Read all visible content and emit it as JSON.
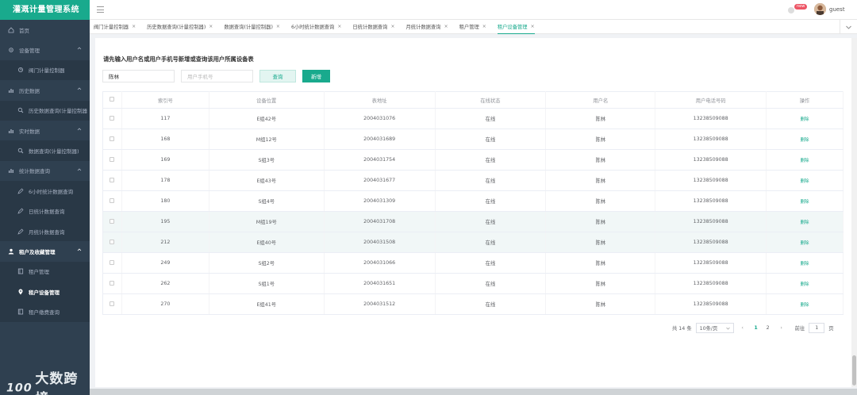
{
  "app": {
    "title": "灌溉计量管理系统"
  },
  "header": {
    "badge": "new",
    "username": "guest"
  },
  "sidebar": {
    "items": [
      {
        "label": "首页",
        "type": "group",
        "icon": "home-icon"
      },
      {
        "label": "设备管理",
        "type": "group",
        "icon": "gear-icon",
        "expanded": true
      },
      {
        "label": "阀门计量控制器",
        "type": "sub",
        "icon": "valve-icon"
      },
      {
        "label": "历史数据",
        "type": "group",
        "icon": "chart-icon",
        "expanded": true
      },
      {
        "label": "历史数据查询(计量控制器",
        "type": "sub",
        "icon": "search-icon"
      },
      {
        "label": "实时数据",
        "type": "group",
        "icon": "chart-icon",
        "expanded": true
      },
      {
        "label": "数据查询(计量控制器)",
        "type": "sub",
        "icon": "search-icon"
      },
      {
        "label": "统计数据查询",
        "type": "group",
        "icon": "chart-icon",
        "expanded": true
      },
      {
        "label": "6小时统计数据查询",
        "type": "sub",
        "icon": "edit-icon"
      },
      {
        "label": "日统计数据查询",
        "type": "sub",
        "icon": "edit-icon"
      },
      {
        "label": "月统计数据查询",
        "type": "sub",
        "icon": "edit-icon"
      },
      {
        "label": "租户及收藏管理",
        "type": "group",
        "icon": "user-icon",
        "expanded": true,
        "strong": true
      },
      {
        "label": "租户管理",
        "type": "sub",
        "icon": "book-icon"
      },
      {
        "label": "租户设备管理",
        "type": "sub",
        "icon": "pin-icon",
        "active": true
      },
      {
        "label": "租户缴费查询",
        "type": "sub",
        "icon": "book-icon"
      }
    ],
    "watermark": "大数跨境"
  },
  "tabs": [
    {
      "label": "阀门计量控制器",
      "close": "×"
    },
    {
      "label": "历史数据查询(计量控制器)",
      "close": "×"
    },
    {
      "label": "数据查询(计量控制器)",
      "close": "×"
    },
    {
      "label": "6小时统计数据查询",
      "close": "×"
    },
    {
      "label": "日统计数据查询",
      "close": "×"
    },
    {
      "label": "月统计数据查询",
      "close": "×"
    },
    {
      "label": "租户管理",
      "close": "×"
    },
    {
      "label": "租户设备管理",
      "close": "×",
      "active": true
    }
  ],
  "main": {
    "title": "请先输入用户名或用户手机号新增或查询该用户所属设备表",
    "name_value": "陈林",
    "phone_placeholder": "用户手机号",
    "query_label": "查询",
    "add_label": "新增"
  },
  "table": {
    "columns": [
      "",
      "索引号",
      "设备位置",
      "表地址",
      "在线状态",
      "用户名",
      "用户电话号码",
      "操作"
    ],
    "rows": [
      {
        "index": "117",
        "location": "E组42号",
        "address": "2004031076",
        "status": "在线",
        "user": "陈林",
        "phone": "13238509088",
        "action": "删除"
      },
      {
        "index": "168",
        "location": "M组12号",
        "address": "2004031689",
        "status": "在线",
        "user": "陈林",
        "phone": "13238509088",
        "action": "删除"
      },
      {
        "index": "169",
        "location": "S组3号",
        "address": "2004031754",
        "status": "在线",
        "user": "陈林",
        "phone": "13238509088",
        "action": "删除"
      },
      {
        "index": "178",
        "location": "E组43号",
        "address": "2004031677",
        "status": "在线",
        "user": "陈林",
        "phone": "13238509088",
        "action": "删除"
      },
      {
        "index": "180",
        "location": "S组4号",
        "address": "2004031309",
        "status": "在线",
        "user": "陈林",
        "phone": "13238509088",
        "action": "删除"
      },
      {
        "index": "195",
        "location": "M组19号",
        "address": "2004031708",
        "status": "在线",
        "user": "陈林",
        "phone": "13238509088",
        "action": "删除",
        "highlight": true
      },
      {
        "index": "212",
        "location": "E组40号",
        "address": "2004031508",
        "status": "在线",
        "user": "陈林",
        "phone": "13238509088",
        "action": "删除",
        "highlight": true
      },
      {
        "index": "249",
        "location": "S组2号",
        "address": "2004031066",
        "status": "在线",
        "user": "陈林",
        "phone": "13238509088",
        "action": "删除"
      },
      {
        "index": "262",
        "location": "S组1号",
        "address": "2004031651",
        "status": "在线",
        "user": "陈林",
        "phone": "13238509088",
        "action": "删除"
      },
      {
        "index": "270",
        "location": "E组41号",
        "address": "2004031512",
        "status": "在线",
        "user": "陈林",
        "phone": "13238509088",
        "action": "删除"
      }
    ]
  },
  "pagination": {
    "total": "共 14 条",
    "page_size": "10条/页",
    "prev": "‹",
    "pages": [
      "1",
      "2"
    ],
    "current": "1",
    "next": "›",
    "goto_label": "前往",
    "goto_value": "1",
    "goto_suffix": "页"
  },
  "colors": {
    "accent": "#19aa8d",
    "sidebar": "#2f4050",
    "badge": "#ed5565"
  }
}
